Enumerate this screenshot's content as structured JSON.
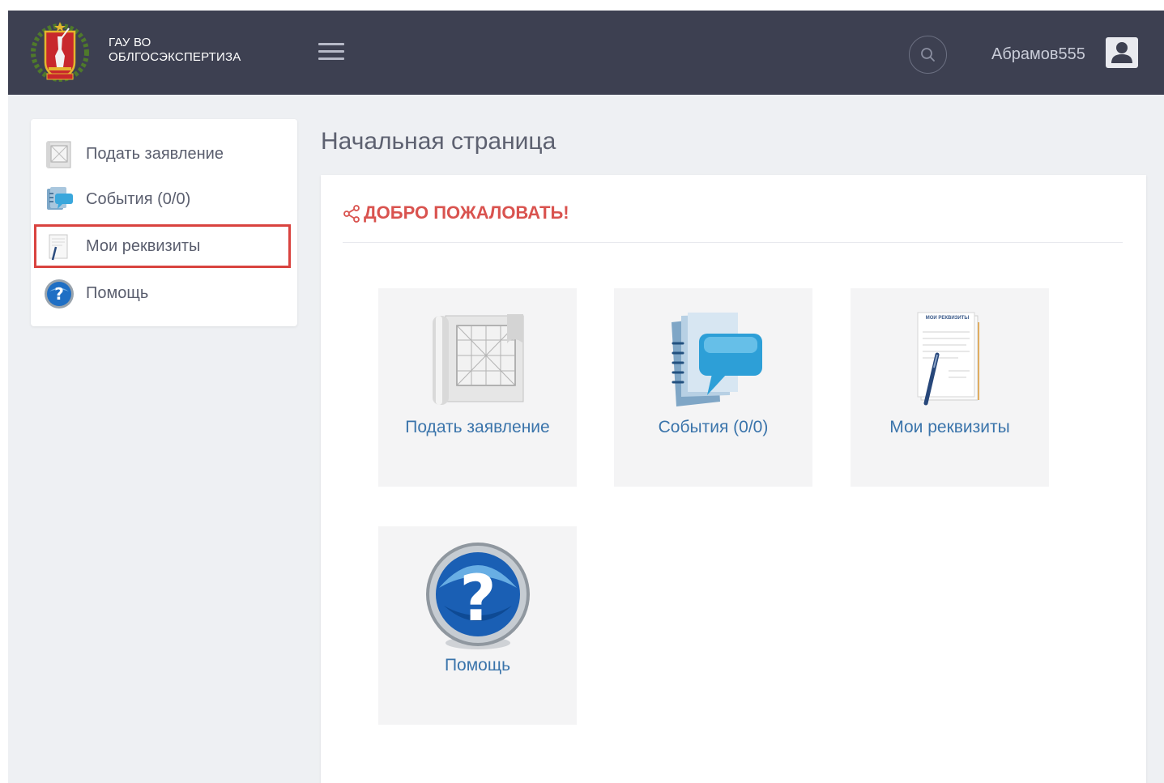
{
  "header": {
    "brand_line1": "ГАУ ВО",
    "brand_line2": "ОБЛГОСЭКСПЕРТИЗА",
    "username": "Абрамов555",
    "bg_color": "#3d4051"
  },
  "sidebar": {
    "items": [
      {
        "label": "Подать заявление",
        "icon": "blueprint-icon"
      },
      {
        "label": "События (0/0)",
        "icon": "events-icon"
      },
      {
        "label": "Мои реквизиты",
        "icon": "requisites-icon",
        "highlighted": true
      },
      {
        "label": "Помощь",
        "icon": "help-icon"
      }
    ]
  },
  "main": {
    "page_title": "Начальная страница",
    "welcome": "ДОБРО ПОЖАЛОВАТЬ!",
    "tiles": [
      {
        "label": "Подать заявление",
        "icon": "blueprint-icon"
      },
      {
        "label": "События (0/0)",
        "icon": "events-icon"
      },
      {
        "label": "Мои реквизиты",
        "icon": "requisites-icon",
        "icon_caption": "МОИ РЕКВИЗИТЫ"
      },
      {
        "label": "Помощь",
        "icon": "help-icon"
      }
    ]
  },
  "colors": {
    "accent_red": "#d9534f",
    "link_blue": "#3a74ab",
    "highlight_border": "#d9433f"
  }
}
